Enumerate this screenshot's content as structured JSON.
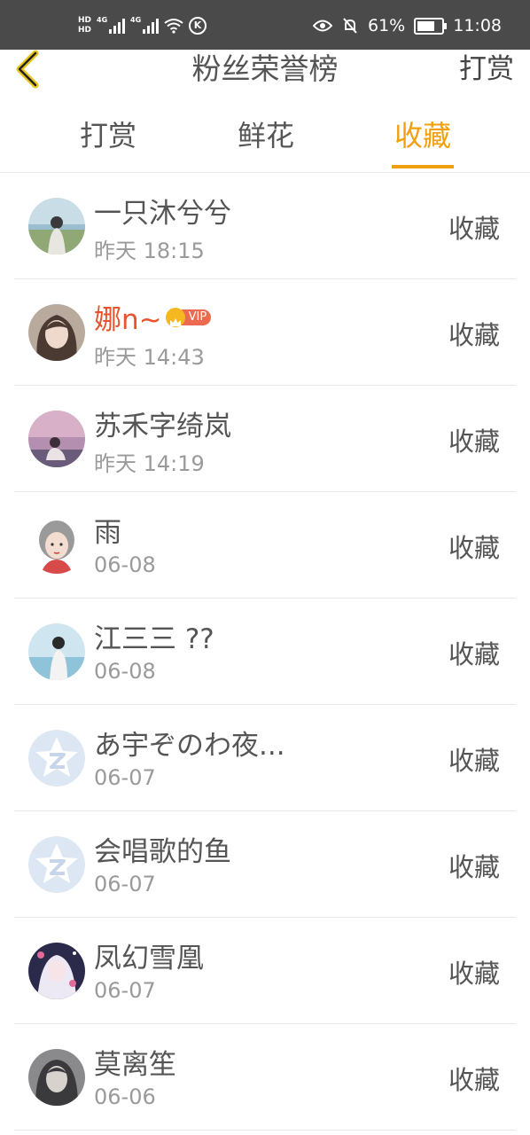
{
  "status_bar": {
    "hd1": "HD",
    "hd2": "HD",
    "net1": "4G",
    "net2": "4G",
    "battery": "61%",
    "time": "11:08"
  },
  "header": {
    "title": "粉丝荣誉榜",
    "right_action": "打赏"
  },
  "tabs": [
    {
      "label": "打赏",
      "active": false
    },
    {
      "label": "鲜花",
      "active": false
    },
    {
      "label": "收藏",
      "active": true
    }
  ],
  "colors": {
    "accent": "#f0a00e",
    "vip_name": "#e8532e"
  },
  "fans": [
    {
      "name": "一只沐兮兮",
      "time": "昨天 18:15",
      "action": "收藏",
      "vip": false,
      "avatar": "photo"
    },
    {
      "name": "娜n~",
      "time": "昨天 14:43",
      "action": "收藏",
      "vip": true,
      "vip_label": "VIP",
      "avatar": "photo"
    },
    {
      "name": "苏禾字绮岚",
      "time": "昨天 14:19",
      "action": "收藏",
      "vip": false,
      "avatar": "photo"
    },
    {
      "name": "雨",
      "time": "06-08",
      "action": "收藏",
      "vip": false,
      "avatar": "illustration"
    },
    {
      "name": "江三三 ??",
      "time": "06-08",
      "action": "收藏",
      "vip": false,
      "avatar": "photo"
    },
    {
      "name": "あ宇ぞのわ夜...",
      "time": "06-07",
      "action": "收藏",
      "vip": false,
      "avatar": "default-logo"
    },
    {
      "name": "会唱歌的鱼",
      "time": "06-07",
      "action": "收藏",
      "vip": false,
      "avatar": "default-logo"
    },
    {
      "name": "凤幻雪凰",
      "time": "06-07",
      "action": "收藏",
      "vip": false,
      "avatar": "illustration"
    },
    {
      "name": "莫离笙",
      "time": "06-06",
      "action": "收藏",
      "vip": false,
      "avatar": "photo"
    }
  ]
}
